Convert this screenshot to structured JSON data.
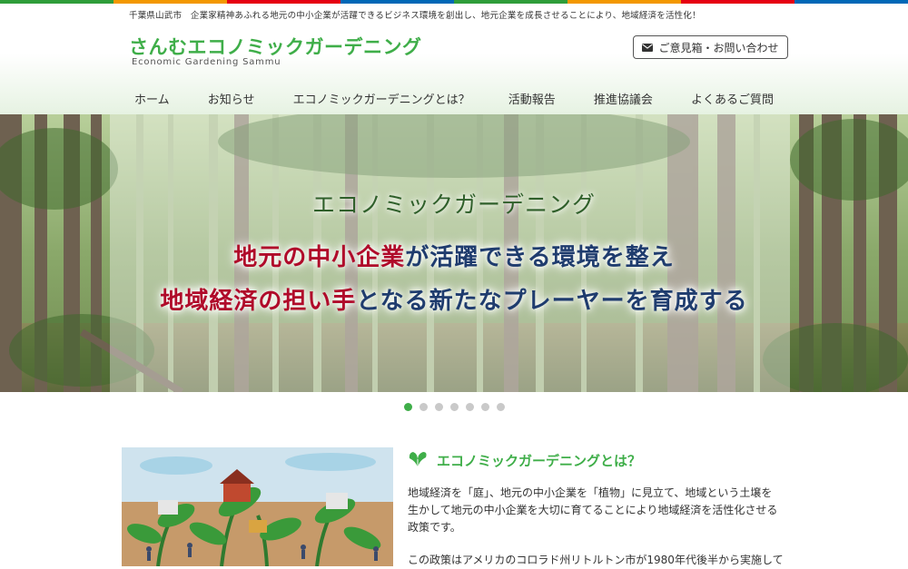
{
  "header": {
    "tagline": "千葉県山武市　企業家精神あふれる地元の中小企業が活躍できるビジネス環境を創出し、地元企業を成長させることにより、地域経済を活性化！",
    "logo_title": "さんむエコノミックガーデニング",
    "logo_subtitle": "Economic Gardening Sammu",
    "contact_label": "ご意見箱・お問い合わせ",
    "contact_icon": "envelope-icon"
  },
  "nav": {
    "items": [
      {
        "label": "ホーム"
      },
      {
        "label": "お知らせ"
      },
      {
        "label": "エコノミックガーデニングとは？"
      },
      {
        "label": "活動報告"
      },
      {
        "label": "推進協議会"
      },
      {
        "label": "よくあるご質問"
      }
    ]
  },
  "hero": {
    "heading": "エコノミックガーデニング",
    "line1_red": "地元の中小企業",
    "line1_rest": "が活躍できる環境を整え",
    "line2_red": "地域経済の担い手",
    "line2_rest": "となる新たなプレーヤーを育成する",
    "colors": {
      "red": "#b00a2a",
      "navy": "#1f3c6e",
      "green": "#2f5f2a"
    }
  },
  "slider": {
    "dot_count": 7,
    "active_index": 0
  },
  "about": {
    "title": "エコノミックガーデニングとは？",
    "title_icon": "leaf-icon",
    "paragraph1": "地域経済を「庭」、地元の中小企業を「植物」に見立て、地域という土壌を生かして地元の中小企業を大切に育てることにより地域経済を活性化させる政策です。",
    "paragraph2": "この政策はアメリカのコロラド州リトルトン市が1980年代後半から実施して"
  },
  "colors": {
    "accent": "#3fae49"
  }
}
